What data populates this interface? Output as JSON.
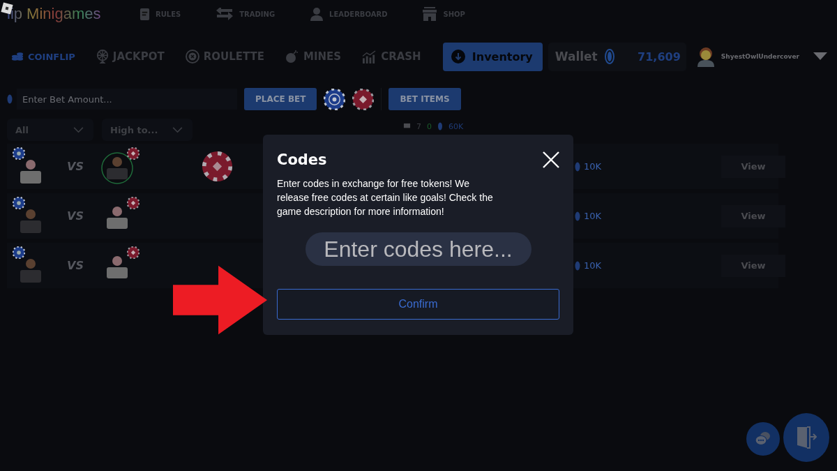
{
  "app": {
    "title": "lip Minigames"
  },
  "top_nav": [
    {
      "label": "RULES"
    },
    {
      "label": "TRADING"
    },
    {
      "label": "LEADERBOARD"
    },
    {
      "label": "SHOP"
    }
  ],
  "game_tabs": [
    {
      "label": "COINFLIP",
      "selected": true
    },
    {
      "label": "JACKPOT",
      "selected": false
    },
    {
      "label": "ROULETTE",
      "selected": false
    },
    {
      "label": "MINES",
      "selected": false
    },
    {
      "label": "CRASH",
      "selected": false
    }
  ],
  "inventory_button": "Inventory",
  "wallet": {
    "label": "Wallet",
    "balance": "71,609"
  },
  "user": {
    "name": "ShyestOwlUndercover"
  },
  "bet_bar": {
    "placeholder": "Enter Bet Amount...",
    "place_bet": "PLACE BET",
    "bet_items": "BET ITEMS"
  },
  "filters": [
    {
      "value": "All"
    },
    {
      "value": "High to..."
    }
  ],
  "stats": {
    "games": "7",
    "players": "0",
    "total": "60K"
  },
  "games": [
    {
      "finished": true,
      "versus": "VS",
      "amount": "10K",
      "action": "View"
    },
    {
      "finished": false,
      "versus": "VS",
      "amount": "10K",
      "action": "View"
    },
    {
      "finished": false,
      "versus": "VS",
      "amount": "10K",
      "action": "View"
    }
  ],
  "modal": {
    "title": "Codes",
    "text": "Enter codes in exchange for free tokens! We release free codes at certain like goals! Check the game description for more information!",
    "placeholder": "Enter codes here...",
    "confirm": "Confirm"
  }
}
